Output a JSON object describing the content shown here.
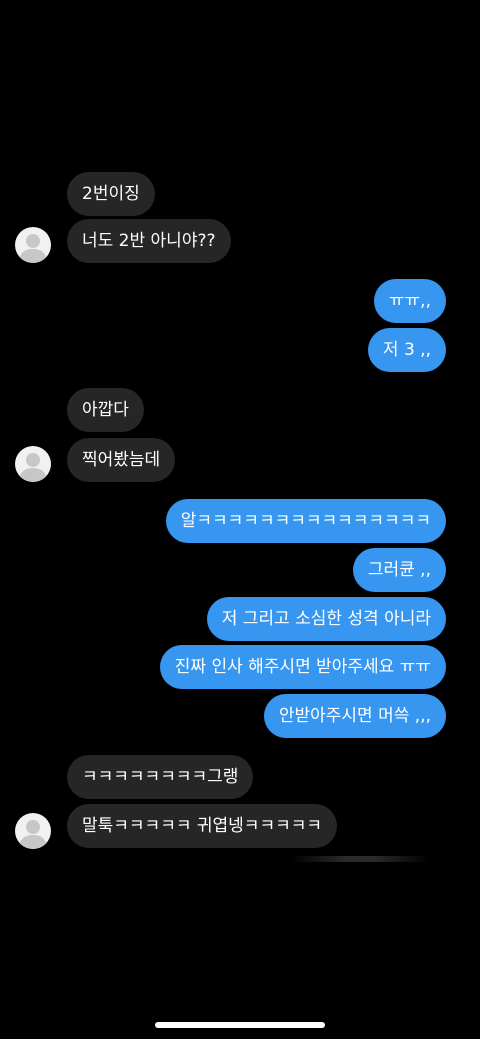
{
  "messages": [
    {
      "text": "2번이징"
    },
    {
      "text": "너도 2반 아니야??"
    },
    {
      "text": "ㅠㅠ,,"
    },
    {
      "text": "저 3 ,,"
    },
    {
      "text": "아깝다"
    },
    {
      "text": "찍어봤늠데"
    },
    {
      "text": "알ㅋㅋㅋㅋㅋㅋㅋㅋㅋㅋㅋㅋㅋㅋㅋ"
    },
    {
      "text": "그러큔 ,,"
    },
    {
      "text": "저 그리고 소심한 성격 아니라"
    },
    {
      "text": "진짜 인사 해주시면 받아주세요 ㅠㅠ"
    },
    {
      "text": "안받아주시면 머쓱 ,,,"
    },
    {
      "text": "ㅋㅋㅋㅋㅋㅋㅋㅋ그랭"
    },
    {
      "text": "말툭ㅋㅋㅋㅋㅋ 귀엽넹ㅋㅋㅋㅋㅋ"
    }
  ],
  "colors": {
    "background": "#000000",
    "received_bubble": "#262626",
    "sent_bubble": "#3797f0",
    "text": "#ffffff"
  },
  "icons": {
    "avatar": "default-profile-avatar-icon"
  }
}
